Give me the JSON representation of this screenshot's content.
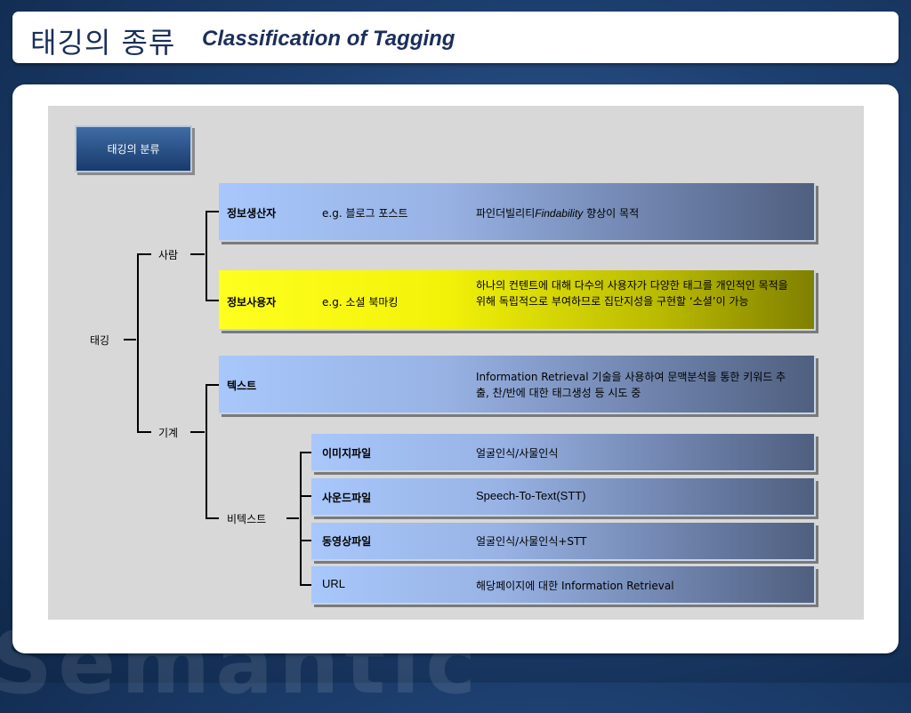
{
  "title": {
    "ko": "태깅의 종류",
    "en": "Classification of Tagging"
  },
  "badge": "태깅의 분류",
  "tree": {
    "root": "태깅",
    "person": "사람",
    "machine": "기계",
    "non_text": "비텍스트"
  },
  "rows": {
    "producer": {
      "name": "정보생산자",
      "example": "e.g. 블로그 포스트",
      "desc_pre": "파인더빌리티",
      "desc_it": "Findability",
      "desc_post": " 향상이 목적"
    },
    "user": {
      "name": "정보사용자",
      "example": "e.g. 소셜 북마킹",
      "desc": "하나의 컨텐트에 대해 다수의 사용자가 다양한 태그를 개인적인 목적을 위해 독립적으로 부여하므로 집단지성을 구현할 ‘소셜’이 가능"
    },
    "text": {
      "name": "텍스트",
      "desc": "Information Retrieval 기술을 사용하여 문맥분석을 통한 키워드 추출, 찬/반에 대한 태그생성 등 시도 중"
    },
    "image": {
      "name": "이미지파일",
      "desc": "얼굴인식/사물인식"
    },
    "sound": {
      "name": "사운드파일",
      "desc": "Speech-To-Text(STT)"
    },
    "video": {
      "name": "동영상파일",
      "desc": "얼굴인식/사물인식+STT"
    },
    "url": {
      "name": "URL",
      "desc": "해당페이지에 대한 Information Retrieval"
    }
  },
  "colors": {
    "navy": "#1a2f5a",
    "box_blue": "#a8c7fb",
    "box_yellow": "#ffff1f",
    "panel_gray": "#d8d8d8"
  }
}
